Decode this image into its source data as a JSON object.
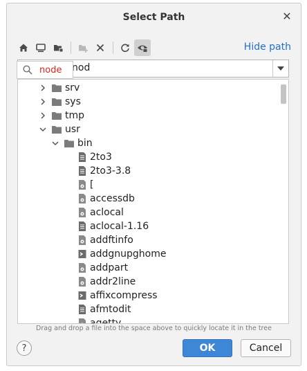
{
  "window": {
    "title": "Select Path"
  },
  "toolbar": {
    "buttons": [
      "home-icon",
      "desktop-icon",
      "project-folder-icon",
      "new-folder-icon",
      "delete-icon",
      "refresh-icon",
      "show-hidden-icon"
    ],
    "hide_path_label": "Hide path"
  },
  "path": {
    "value": "nod"
  },
  "search": {
    "text": "node"
  },
  "tree": {
    "items": [
      {
        "label": "srv",
        "type": "folder",
        "level": 0,
        "expanded": false
      },
      {
        "label": "sys",
        "type": "folder",
        "level": 0,
        "expanded": false
      },
      {
        "label": "tmp",
        "type": "folder",
        "level": 0,
        "expanded": false
      },
      {
        "label": "usr",
        "type": "folder",
        "level": 0,
        "expanded": true
      },
      {
        "label": "bin",
        "type": "folder",
        "level": 1,
        "expanded": true
      },
      {
        "label": "2to3",
        "type": "script",
        "level": 2
      },
      {
        "label": "2to3-3.8",
        "type": "script",
        "level": 2
      },
      {
        "label": "[",
        "type": "exec",
        "level": 2
      },
      {
        "label": "accessdb",
        "type": "exec",
        "level": 2
      },
      {
        "label": "aclocal",
        "type": "exec",
        "level": 2
      },
      {
        "label": "aclocal-1.16",
        "type": "script",
        "level": 2
      },
      {
        "label": "addftinfo",
        "type": "exec",
        "level": 2
      },
      {
        "label": "addgnupghome",
        "type": "shell",
        "level": 2
      },
      {
        "label": "addpart",
        "type": "exec",
        "level": 2
      },
      {
        "label": "addr2line",
        "type": "exec",
        "level": 2
      },
      {
        "label": "affixcompress",
        "type": "shell",
        "level": 2
      },
      {
        "label": "afmtodit",
        "type": "script",
        "level": 2
      },
      {
        "label": "agetty",
        "type": "exec",
        "level": 2
      }
    ]
  },
  "hint": "Drag and drop a file into the space above to quickly locate it in the tree",
  "buttons": {
    "help": "?",
    "ok": "OK",
    "cancel": "Cancel"
  },
  "colors": {
    "accent": "#3e86d6",
    "link": "#2470c4",
    "search_text": "#d7261e"
  }
}
